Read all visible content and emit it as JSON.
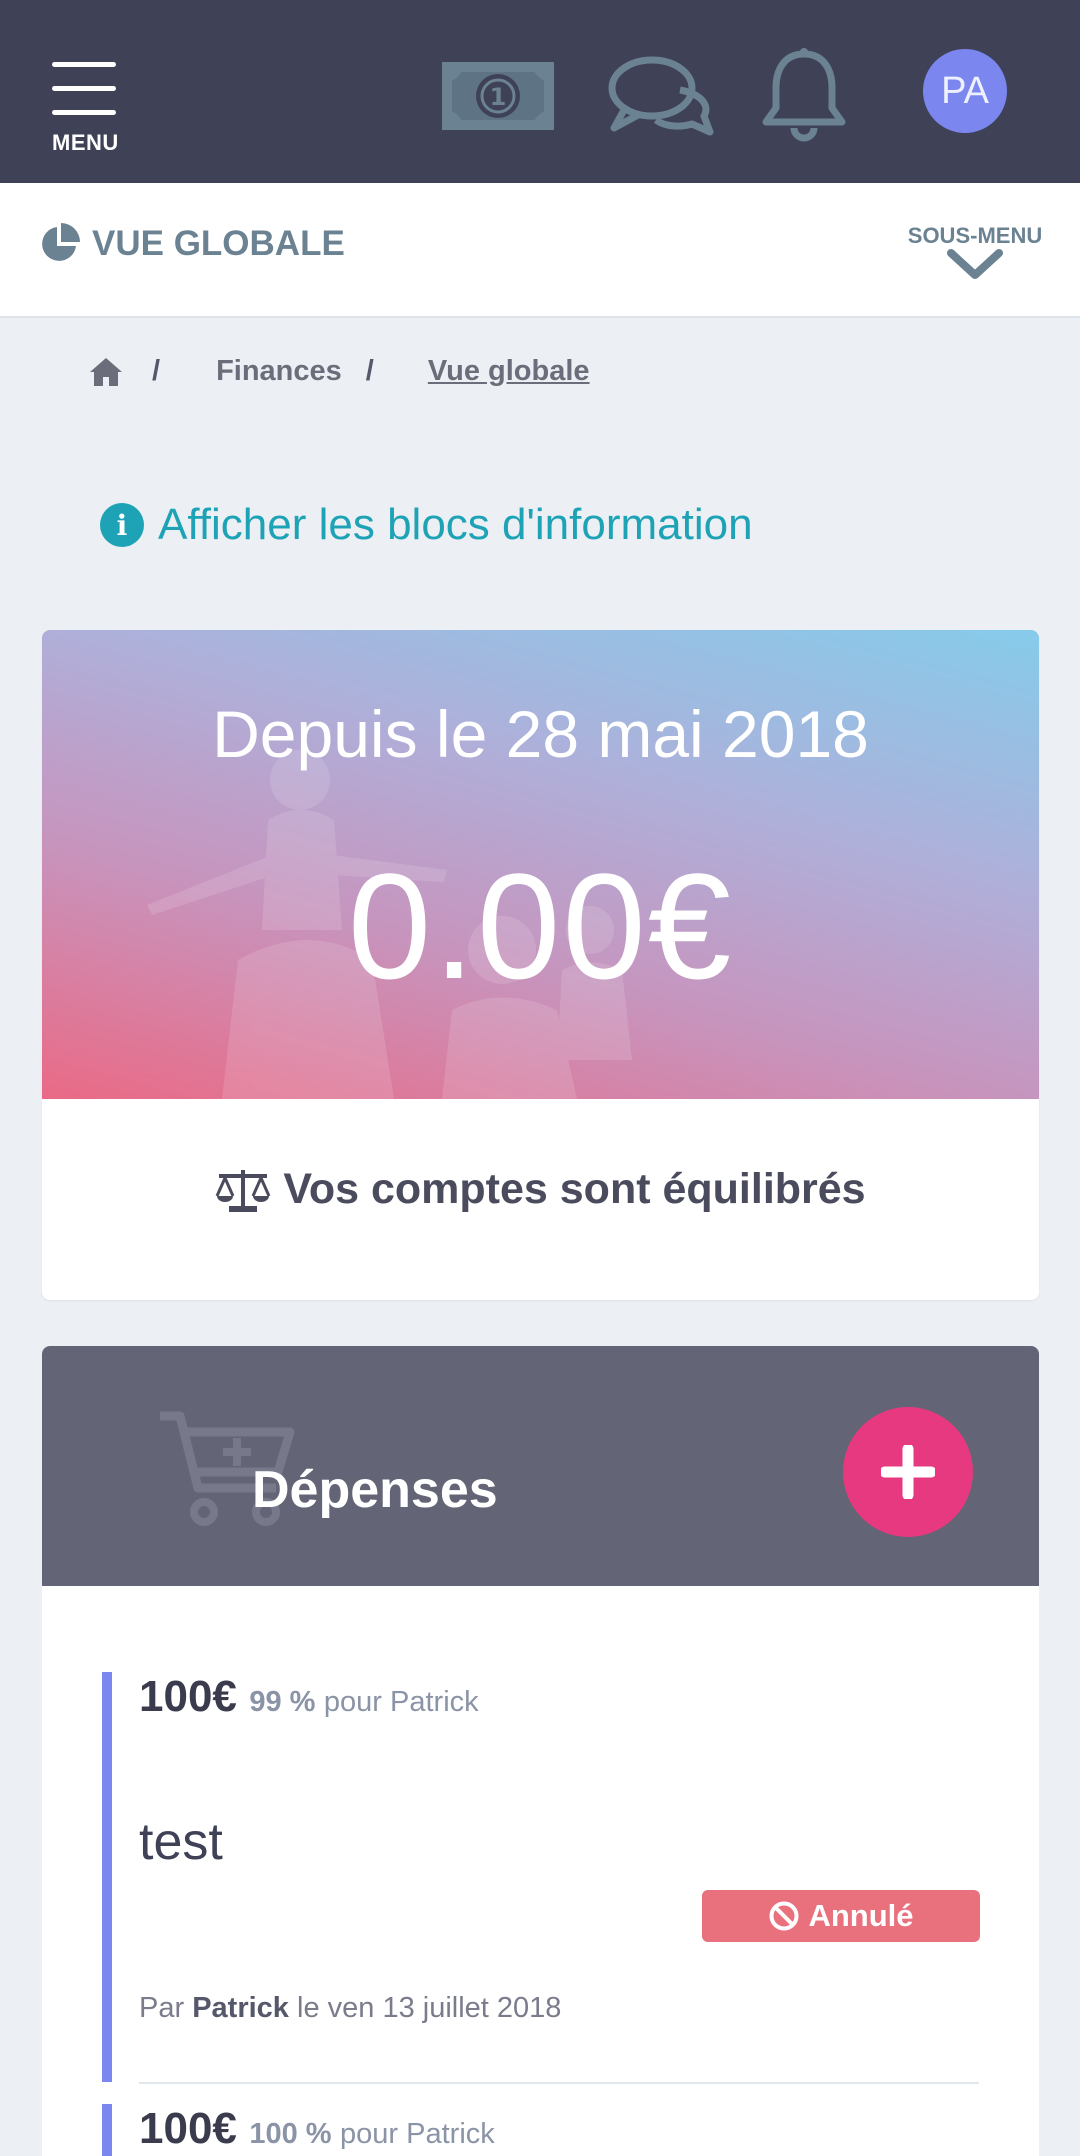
{
  "topbar": {
    "menu_label": "MENU",
    "icons": [
      "money-icon",
      "chat-icon",
      "bell-icon"
    ],
    "avatar_initials": "PA",
    "avatar_color": "#7b86ee",
    "background": "#3f4157"
  },
  "subheader": {
    "title": "VUE GLOBALE",
    "submenu_label": "SOUS-MENU"
  },
  "breadcrumb": {
    "sep": "/",
    "items": [
      "Finances",
      "Vue globale"
    ]
  },
  "info_link": {
    "label": "Afficher les blocs d'information",
    "color": "#1ea3b6"
  },
  "hero": {
    "since_label": "Depuis le 28 mai 2018",
    "amount": "0.00€",
    "balance_status": "Vos comptes sont équilibrés"
  },
  "expenses": {
    "title": "Dépenses",
    "add_color": "#e7397f",
    "items": [
      {
        "amount": "100€",
        "percent": "99 %",
        "for_label": "pour Patrick",
        "name": "test",
        "status": "Annulé",
        "meta_prefix": "Par",
        "author": "Patrick",
        "meta_suffix": "le ven 13 juillet 2018"
      },
      {
        "amount": "100€",
        "percent": "100 %",
        "for_label": "pour Patrick"
      }
    ]
  }
}
